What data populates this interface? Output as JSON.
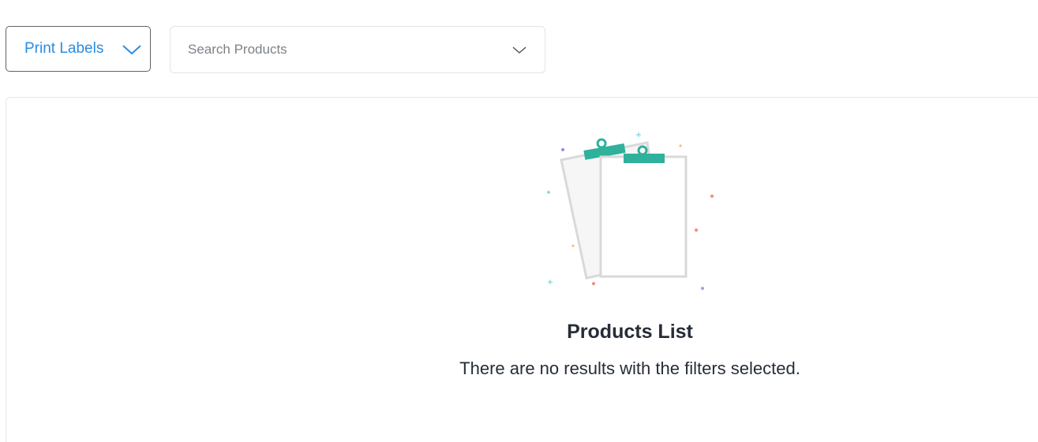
{
  "toolbar": {
    "print_labels": "Print Labels",
    "search_placeholder": "Search Products",
    "search_value": ""
  },
  "empty_state": {
    "title": "Products List",
    "message": "There are no results with the filters selected."
  },
  "icons": {
    "print_dropdown": "chevron-down-icon",
    "search_dropdown": "chevron-down-icon",
    "illustration": "clipboard-illustration"
  },
  "colors": {
    "accent": "#2b8ce0",
    "clip": "#2fb19c",
    "text_dark": "#262d38"
  }
}
